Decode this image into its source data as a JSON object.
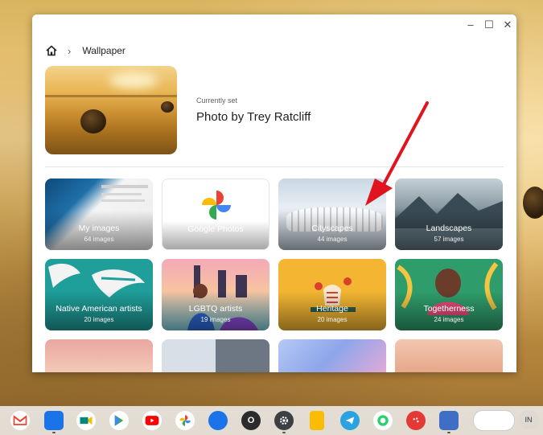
{
  "breadcrumb": {
    "home_icon": "home-icon",
    "separator_icon": "chevron-right-icon",
    "title": "Wallpaper"
  },
  "window_controls": {
    "minimize": "–",
    "maximize": "☐",
    "close": "✕"
  },
  "current": {
    "label": "Currently set",
    "title": "Photo by Trey Ratcliff"
  },
  "collections": [
    {
      "name": "My images",
      "count": "64 images"
    },
    {
      "name": "Google Photos",
      "count": ""
    },
    {
      "name": "Cityscapes",
      "count": "44 images"
    },
    {
      "name": "Landscapes",
      "count": "57 images"
    },
    {
      "name": "Native American artists",
      "count": "20 images"
    },
    {
      "name": "LGBTQ artists",
      "count": "19 images"
    },
    {
      "name": "Heritage",
      "count": "20 images"
    },
    {
      "name": "Togetherness",
      "count": "24 images"
    }
  ],
  "shelf": {
    "apps": [
      "gmail-icon",
      "files-icon",
      "meet-icon",
      "play-store-icon",
      "youtube-icon",
      "photos-icon",
      "messages-icon",
      "o-app-icon",
      "settings-icon",
      "keep-icon",
      "telegram-icon",
      "whatsapp-icon",
      "palette-icon",
      "wallpaper-app-icon"
    ],
    "o_app_label": "O",
    "language": "IN"
  },
  "colors": {
    "accent_arrow": "#e0141e",
    "window_bg": "#ffffff"
  }
}
